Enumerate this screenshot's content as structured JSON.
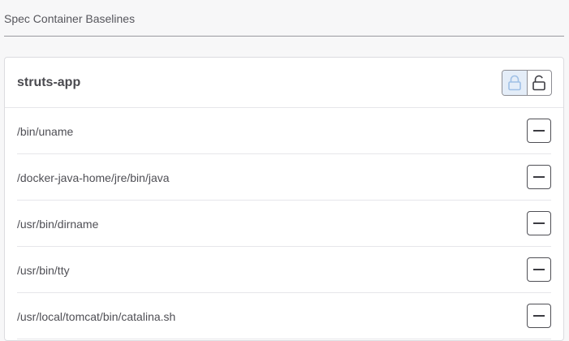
{
  "header": {
    "title": "Spec Container Baselines"
  },
  "card": {
    "title": "struts-app",
    "lock_toggle": {
      "locked_icon": "lock-icon",
      "unlocked_icon": "unlock-icon",
      "active": "locked"
    },
    "items": [
      {
        "label": "/bin/uname",
        "action_icon": "minus-icon"
      },
      {
        "label": "/docker-java-home/jre/bin/java",
        "action_icon": "minus-icon"
      },
      {
        "label": "/usr/bin/dirname",
        "action_icon": "minus-icon"
      },
      {
        "label": "/usr/bin/tty",
        "action_icon": "minus-icon"
      },
      {
        "label": "/usr/local/tomcat/bin/catalina.sh",
        "action_icon": "minus-icon"
      }
    ]
  },
  "colors": {
    "lock_active_bg": "#e4edf8",
    "lock_active_icon": "#9fc0e6"
  }
}
